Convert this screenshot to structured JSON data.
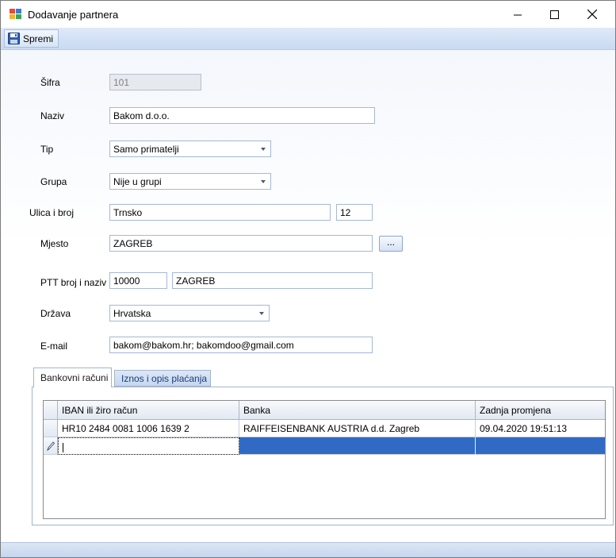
{
  "window": {
    "title": "Dodavanje partnera",
    "minimize": "—",
    "maximize": "☐",
    "close": "✕"
  },
  "toolbar": {
    "save_label": "Spremi"
  },
  "form": {
    "sifra": {
      "label": "Šifra",
      "value": "101"
    },
    "naziv": {
      "label": "Naziv",
      "value": "Bakom d.o.o."
    },
    "tip": {
      "label": "Tip",
      "value": "Samo primatelji"
    },
    "grupa": {
      "label": "Grupa",
      "value": "Nije u grupi"
    },
    "ulica": {
      "label": "Ulica i broj",
      "street": "Trnsko",
      "number": "12"
    },
    "mjesto": {
      "label": "Mjesto",
      "value": "ZAGREB",
      "browse": "..."
    },
    "ptt": {
      "label": "PTT broj i naziv",
      "code": "10000",
      "name": "ZAGREB"
    },
    "drzava": {
      "label": "Država",
      "value": "Hrvatska"
    },
    "email": {
      "label": "E-mail",
      "value": "bakom@bakom.hr; bakomdoo@gmail.com"
    }
  },
  "tabs": [
    {
      "label": "Bankovni računi",
      "active": true
    },
    {
      "label": "Iznos i opis plaćanja",
      "active": false
    }
  ],
  "grid": {
    "columns": [
      "IBAN ili žiro račun",
      "Banka",
      "Zadnja promjena"
    ],
    "rows": [
      [
        "HR10 2484 0081 1006 1639 2",
        "RAIFFEISENBANK AUSTRIA d.d. Zagreb",
        "09.04.2020 19:51:13"
      ]
    ]
  },
  "colors": {
    "accent": "#316ac5",
    "toolbar": "#c9daf2",
    "border": "#a4b9d8"
  },
  "icons": {
    "app": "app-icon",
    "save": "floppy-disk-icon",
    "edit_row": "pencil-icon"
  }
}
